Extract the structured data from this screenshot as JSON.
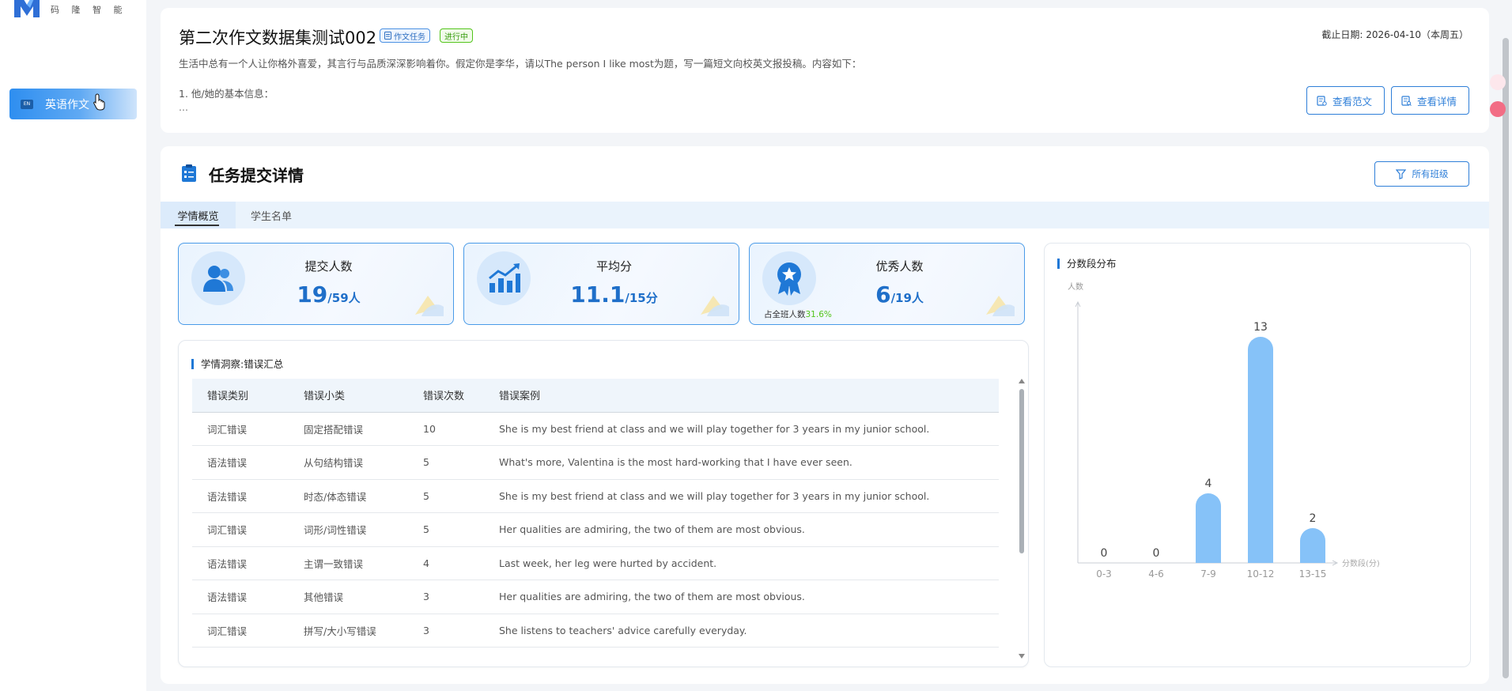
{
  "sidebar": {
    "logo_text": "码 隆 智 能",
    "nav": [
      {
        "badge": "EN",
        "label": "英语作文"
      }
    ]
  },
  "task": {
    "title": "第二次作文数据集测试002",
    "type_tag": "作文任务",
    "status_tag": "进行中",
    "deadline": "截止日期: 2026-04-10（本周五）",
    "description": "生活中总有一个人让你格外喜爱，其言行与品质深深影响着你。假定你是李华，请以The person I like most为题，写一篇短文向校英文报投稿。内容如下：",
    "description_item": "1. 他/她的基本信息：",
    "description_more": "...",
    "btn_sample": "查看范文",
    "btn_detail": "查看详情"
  },
  "submission": {
    "title": "任务提交详情",
    "class_filter": "所有班级",
    "tabs": [
      "学情概览",
      "学生名单"
    ],
    "active_tab": 0
  },
  "stats": [
    {
      "label": "提交人数",
      "value": "19",
      "suffix": "/59人",
      "icon": "users-icon"
    },
    {
      "label": "平均分",
      "value": "11.1",
      "suffix": "/15分",
      "icon": "trend-chart-icon"
    },
    {
      "label": "优秀人数",
      "value": "6",
      "suffix": "/19人",
      "icon": "award-icon",
      "sub_label": "占全班人数",
      "sub_value": "31.6%"
    }
  ],
  "errors": {
    "title": "学情洞察:错误汇总",
    "columns": [
      "错误类别",
      "错误小类",
      "错误次数",
      "错误案例"
    ],
    "rows": [
      [
        "词汇错误",
        "固定搭配错误",
        "10",
        "She is my best friend at class and we will play together for 3 years in my junior school."
      ],
      [
        "语法错误",
        "从句结构错误",
        "5",
        "What's more, Valentina is the most hard-working that I have ever seen."
      ],
      [
        "语法错误",
        "时态/体态错误",
        "5",
        "She is my best friend at class and we will play together for 3 years in my junior school."
      ],
      [
        "词汇错误",
        "词形/词性错误",
        "5",
        "Her qualities are admiring, the two of them are most obvious."
      ],
      [
        "语法错误",
        "主谓一致错误",
        "4",
        "Last week, her leg were hurted by accident."
      ],
      [
        "语法错误",
        "其他错误",
        "3",
        "Her qualities are admiring, the two of them are most obvious."
      ],
      [
        "词汇错误",
        "拼写/大小写错误",
        "3",
        "She listens to teachers' advice carefully everyday."
      ]
    ]
  },
  "chart_data": {
    "type": "bar",
    "title": "分数段分布",
    "ylabel": "人数",
    "xlabel": "分数段(分)",
    "categories": [
      "0-3",
      "4-6",
      "7-9",
      "10-12",
      "13-15"
    ],
    "values": [
      0,
      0,
      4,
      13,
      2
    ],
    "ylim": [
      0,
      13
    ],
    "grid": false,
    "bar_color": "#86c2f8",
    "data_labels": true
  },
  "colors": {
    "accent": "#1f78d6",
    "success": "#52c41a",
    "nav_gradient_start": "#2e8ef0"
  }
}
